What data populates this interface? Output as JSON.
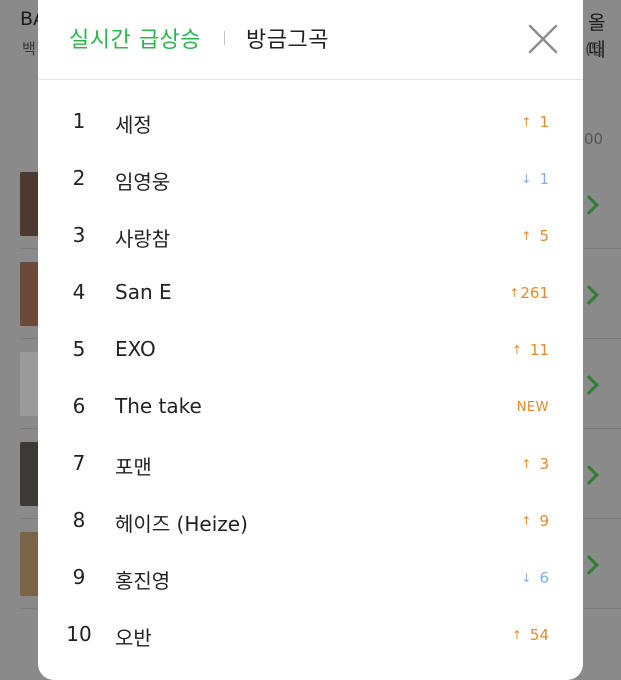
{
  "background": {
    "top_left_text": "BA",
    "top_left_sub": "백",
    "top_right_text": "올때",
    "top_right_sub": "(뎁",
    "side_number": "00"
  },
  "panel": {
    "tabs": [
      {
        "label": "실시간 급상승",
        "active": true
      },
      {
        "label": "방금그곡",
        "active": false
      }
    ],
    "close_icon": "close-x-icon",
    "accent_color": "#2cb54a",
    "up_color": "#e58a2c",
    "down_color": "#7fb1e3"
  },
  "chart": {
    "items": [
      {
        "rank": "1",
        "artist": "세정",
        "direction": "up",
        "arrow": "↑",
        "change": "1"
      },
      {
        "rank": "2",
        "artist": "임영웅",
        "direction": "down",
        "arrow": "↓",
        "change": "1"
      },
      {
        "rank": "3",
        "artist": "사랑참",
        "direction": "up",
        "arrow": "↑",
        "change": "5"
      },
      {
        "rank": "4",
        "artist": "San E",
        "direction": "up",
        "arrow": "↑",
        "change": "261"
      },
      {
        "rank": "5",
        "artist": "EXO",
        "direction": "up",
        "arrow": "↑",
        "change": "11"
      },
      {
        "rank": "6",
        "artist": "The take",
        "direction": "new",
        "arrow": "",
        "change": "NEW"
      },
      {
        "rank": "7",
        "artist": "포맨",
        "direction": "up",
        "arrow": "↑",
        "change": "3"
      },
      {
        "rank": "8",
        "artist": "헤이즈 (Heize)",
        "direction": "up",
        "arrow": "↑",
        "change": "9"
      },
      {
        "rank": "9",
        "artist": "홍진영",
        "direction": "down",
        "arrow": "↓",
        "change": "6"
      },
      {
        "rank": "10",
        "artist": "오반",
        "direction": "up",
        "arrow": "↑",
        "change": "54"
      }
    ]
  }
}
